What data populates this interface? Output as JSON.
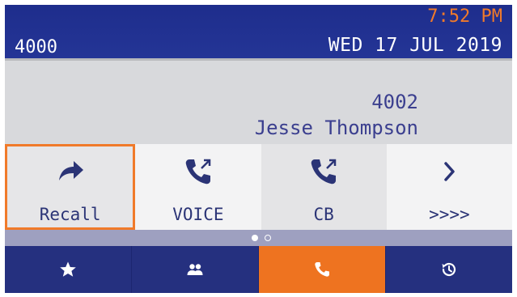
{
  "header": {
    "extension": "4000",
    "time": "7:52 PM",
    "date": "WED 17 JUL 2019"
  },
  "caller": {
    "number": "4002",
    "name": "Jesse Thompson"
  },
  "softkeys": [
    {
      "label": "Recall",
      "icon": "recall-arrow-icon"
    },
    {
      "label": "VOICE",
      "icon": "voice-call-icon"
    },
    {
      "label": "CB",
      "icon": "callback-icon"
    },
    {
      "label": ">>>>",
      "icon": "chevron-right-icon"
    }
  ],
  "pager": {
    "current_page": 1,
    "total_pages": 2
  },
  "nav": [
    {
      "icon": "star-icon",
      "active": false
    },
    {
      "icon": "contacts-icon",
      "active": false
    },
    {
      "icon": "phone-icon",
      "active": true
    },
    {
      "icon": "history-icon",
      "active": false
    }
  ],
  "colors": {
    "header_bg": "#243596",
    "accent": "#ee7320",
    "text_primary": "#2b3476"
  }
}
